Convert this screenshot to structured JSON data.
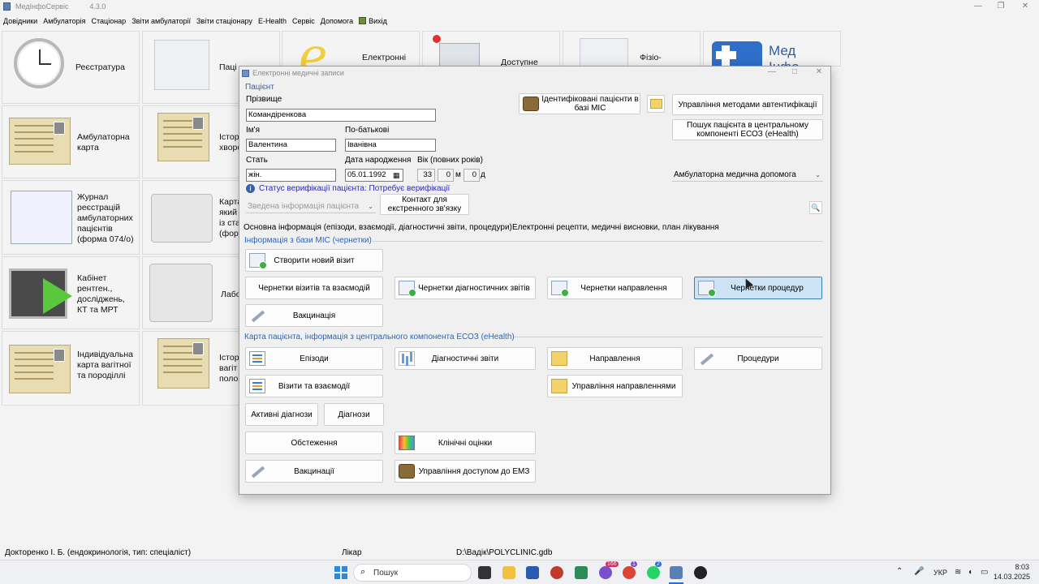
{
  "app": {
    "title": "МедІнфоСервіс",
    "version": "4.3.0"
  },
  "menu": [
    "Довідники",
    "Амбулаторія",
    "Стаціонар",
    "Звіти амбулаторії",
    "Звіти стаціонару",
    "E-Health",
    "Сервіс",
    "Допомога",
    "Вихід"
  ],
  "tiles": {
    "registry": "Реєстратура",
    "outpatient_card": "Амбулаторна карта",
    "journal": "Журнал реєстрацій амбулаторних пацієнтів (форма 074/о)",
    "xray": "Кабінет рентген., досліджень, КТ та МРТ",
    "pregnancy": "Індивідуальна карта вагітної та породіллі",
    "col2_a": "Паці",
    "col2_b": "Істор хворо",
    "col2_c": "Карта який із ста (фор",
    "col2_d": "Лабо",
    "col2_e": "Істор вагіт поло",
    "e_records": "Електронні",
    "available": "Доступне",
    "physio": "Фізіо-",
    "med_info": "Мед Інфо"
  },
  "dialog": {
    "title": "Електронні медичні записи",
    "patient_group": "Пацієнт",
    "surname_label": "Прізвище",
    "surname_value": "Командіренкова",
    "name_label": "Ім'я",
    "name_value": "Валентина",
    "patronymic_label": "По-батькові",
    "patronymic_value": "Іванівна",
    "sex_label": "Стать",
    "sex_value": "жін.",
    "dob_label": "Дата народження",
    "dob_value": "05.01.1992",
    "age_label": "Вік (повних років)",
    "age_years": "33",
    "age_months": "0",
    "age_months_unit": "м",
    "age_days": "0",
    "age_days_unit": "д",
    "verification_status": "Статус верифікації пацієнта: Потребує верифікації",
    "summary_combo": "Зведена інформація пацієнта",
    "emergency_contact": "Контакт для екстренного зв'язку",
    "identified_patients": "Ідентифіковані пацієнти в базі МІС",
    "auth_methods": "Управління методами автентифікації",
    "search_central": "Пошук пацієнта в центральному компоненті ЕСОЗ (eHealth)",
    "care_type": "Амбулаторна медична допомога",
    "tab_main": "Основна інформація (епізоди, взаємодії, діагностичні звіти, процедури)",
    "tab_erx": "Електронні рецепти, медичні висновки, план лікування",
    "mis_group": "Інформація з бази МІС (чернетки)",
    "new_visit": "Створити новий візит",
    "draft_visits": "Чернетки візитів та взаємодій",
    "draft_diag": "Чернетки діагностичних звітів",
    "draft_referral": "Чернетки направлення",
    "draft_procedures": "Чернетки процедур",
    "vaccination_draft": "Вакцинація",
    "card_group": "Карта пацієнта, інформація з центрального компонента ЕСОЗ (eHealth)",
    "episodes": "Епізоди",
    "diag_reports": "Діагностичні звіти",
    "referrals": "Направлення",
    "procedures": "Процедури",
    "visits": "Візити та взаємодії",
    "manage_referrals": "Управління направленнями",
    "active_diag": "Активні діагнози",
    "diagnoses": "Діагнози",
    "examinations": "Обстеження",
    "clinical_eval": "Клінічні оцінки",
    "vaccinations": "Вакцинації",
    "emz_access": "Управління доступом до ЕМЗ"
  },
  "status": {
    "user": "Докторенко І. Б. (ендокринологія, тип: спеціаліст)",
    "role": "Лікар",
    "db": "D:\\Вадік\\POLYCLINIC.gdb"
  },
  "taskbar": {
    "search": "Пошук",
    "lang": "УКР",
    "time": "8:03",
    "date": "14.03.2025",
    "badge_viber": "166",
    "badge_chrome": "1",
    "badge_whatsapp": "2"
  }
}
